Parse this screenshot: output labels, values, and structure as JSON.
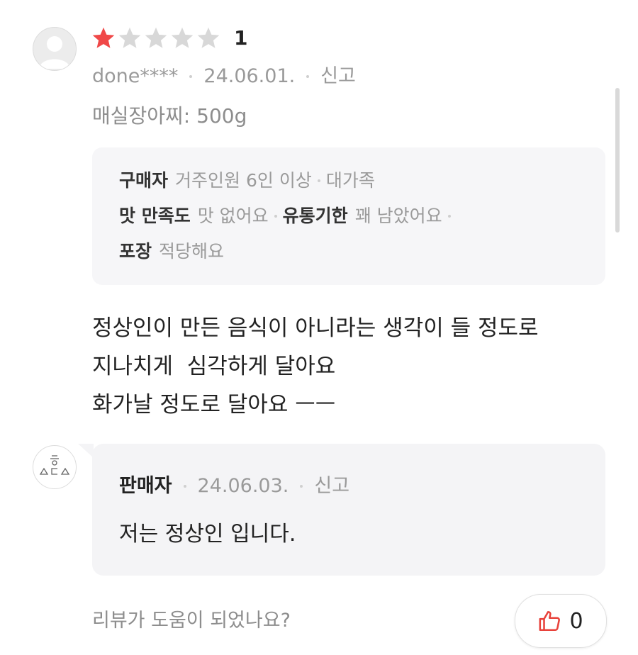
{
  "review": {
    "rating_value": 1,
    "rating_max": 5,
    "rating_label": "1",
    "username": "done****",
    "date": "24.06.01.",
    "report_label": "신고",
    "option": "매실장아찌: 500g",
    "survey": [
      {
        "label": "구매자",
        "values": [
          "거주인원 6인 이상",
          "대가족"
        ]
      },
      {
        "label": "맛 만족도",
        "values": [
          "맛 없어요"
        ],
        "label2": "유통기한",
        "values2": [
          "꽤 남았어요"
        ]
      },
      {
        "label": "포장",
        "values": [
          "적당해요"
        ]
      }
    ],
    "content_lines": [
      "정상인이 만든 음식이 아니라는 생각이 들 정도로",
      "지나치게  심각하게 달아요",
      "화가날 정도로 달아요 ㅡㅡ"
    ]
  },
  "reply": {
    "seller_label": "판매자",
    "date": "24.06.03.",
    "report_label": "신고",
    "text": "저는 정상인 입니다."
  },
  "footer": {
    "helpful_question": "리뷰가 도움이 되었나요?",
    "like_count": "0"
  },
  "colors": {
    "star_filled": "#f04848",
    "star_empty": "#d8d8d8",
    "thumb_icon": "#e8423b"
  }
}
